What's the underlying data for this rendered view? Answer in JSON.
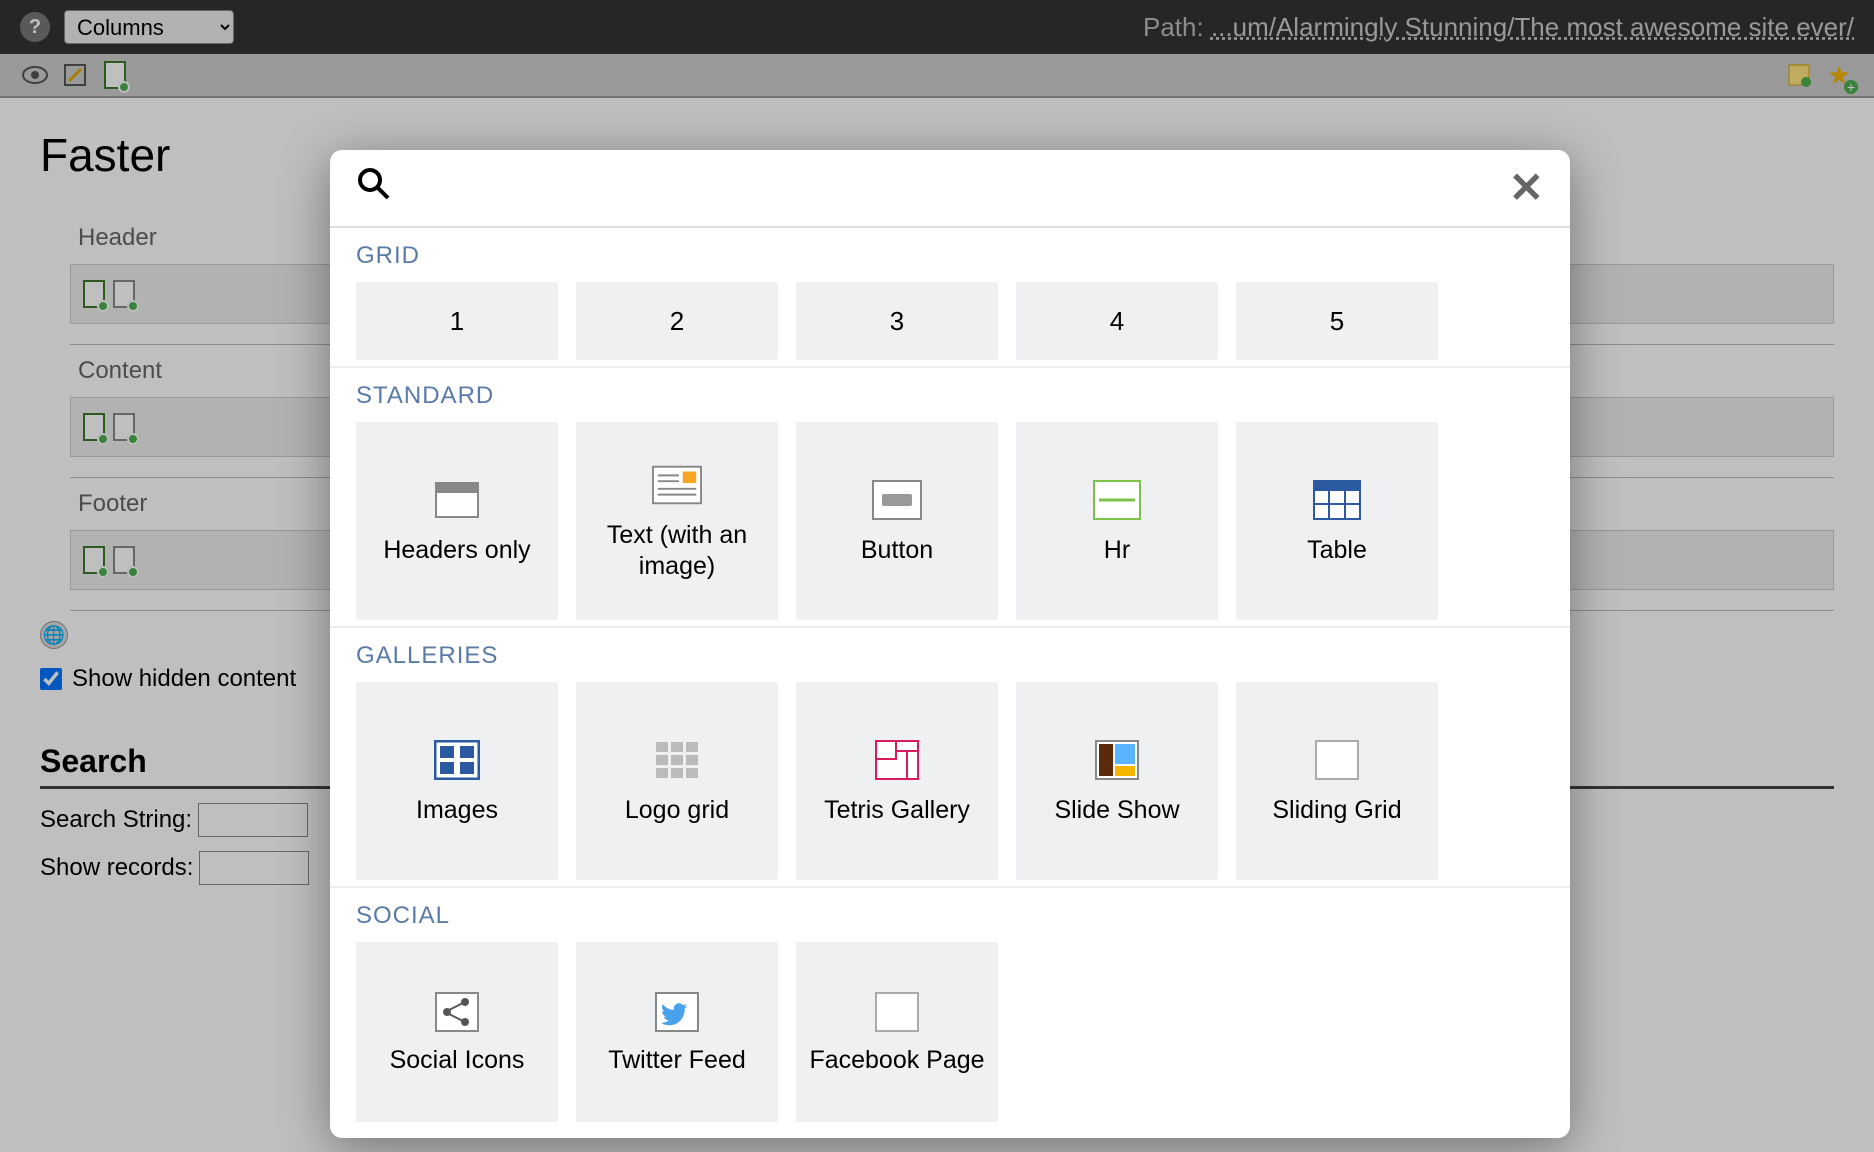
{
  "topbar": {
    "select_value": "Columns",
    "path_label": "Path:",
    "path_text": "...um/Alarmingly Stunning/The most awesome site ever/"
  },
  "page": {
    "title": "Faster",
    "regions": [
      "Header",
      "Content",
      "Footer"
    ],
    "show_hidden_label": "Show hidden content",
    "show_hidden_checked": true,
    "search_heading": "Search",
    "search_string_label": "Search String:",
    "show_records_label": "Show records:"
  },
  "modal": {
    "search_placeholder": "",
    "sections": {
      "grid": {
        "title": "GRID",
        "items": [
          "1",
          "2",
          "3",
          "4",
          "5"
        ]
      },
      "standard": {
        "title": "STANDARD",
        "items": [
          {
            "label": "Headers only",
            "icon": "headers-icon"
          },
          {
            "label": "Text (with an image)",
            "icon": "text-image-icon"
          },
          {
            "label": "Button",
            "icon": "button-icon"
          },
          {
            "label": "Hr",
            "icon": "hr-icon"
          },
          {
            "label": "Table",
            "icon": "table-icon"
          }
        ]
      },
      "galleries": {
        "title": "GALLERIES",
        "items": [
          {
            "label": "Images",
            "icon": "images-icon"
          },
          {
            "label": "Logo grid",
            "icon": "logo-grid-icon"
          },
          {
            "label": "Tetris Gallery",
            "icon": "tetris-icon"
          },
          {
            "label": "Slide Show",
            "icon": "slideshow-icon"
          },
          {
            "label": "Sliding Grid",
            "icon": "sliding-grid-icon"
          }
        ]
      },
      "social": {
        "title": "SOCIAL",
        "items": [
          {
            "label": "Social Icons",
            "icon": "share-icon"
          },
          {
            "label": "Twitter Feed",
            "icon": "twitter-icon"
          },
          {
            "label": "Facebook Page",
            "icon": "facebook-icon"
          }
        ]
      }
    }
  }
}
